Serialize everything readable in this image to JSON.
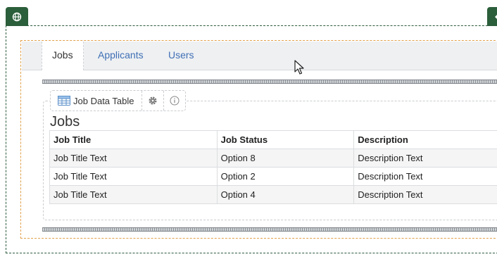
{
  "tabs": [
    {
      "label": "Jobs",
      "active": true
    },
    {
      "label": "Applicants",
      "active": false
    },
    {
      "label": "Users",
      "active": false
    }
  ],
  "component": {
    "label": "Job Data Table"
  },
  "table": {
    "title": "Jobs",
    "columns": [
      "Job Title",
      "Job Status",
      "Description"
    ],
    "rows": [
      [
        "Job Title Text",
        "Option 8",
        "Description Text"
      ],
      [
        "Job Title Text",
        "Option 2",
        "Description Text"
      ],
      [
        "Job Title Text",
        "Option 4",
        "Description Text"
      ]
    ]
  },
  "colors": {
    "badge": "#2b5e3a",
    "tab_link": "#3f6fb5",
    "orange_outline": "#e1a04a"
  },
  "icons": {
    "left_badge": "globe-icon",
    "right_badge": "arrows-icon",
    "table": "table-icon",
    "settings": "gear-icon",
    "info": "info-icon"
  }
}
